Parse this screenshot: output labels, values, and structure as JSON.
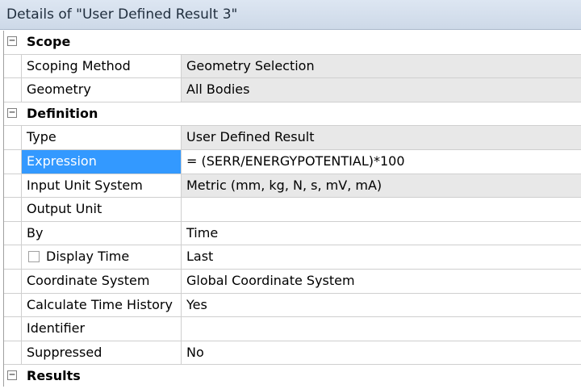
{
  "window": {
    "title": "Details of \"User Defined Result 3\""
  },
  "groups": {
    "scope": {
      "label": "Scope",
      "toggle": "−"
    },
    "definition": {
      "label": "Definition",
      "toggle": "−"
    },
    "results": {
      "label": "Results",
      "toggle": "−"
    }
  },
  "rows": {
    "scoping_method": {
      "name": "Scoping Method",
      "value": "Geometry Selection"
    },
    "geometry": {
      "name": "Geometry",
      "value": "All Bodies"
    },
    "type": {
      "name": "Type",
      "value": "User Defined Result"
    },
    "expression": {
      "name": "Expression",
      "value": "= (SERR/ENERGYPOTENTIAL)*100"
    },
    "input_unit_system": {
      "name": "Input Unit System",
      "value": "Metric (mm, kg, N, s, mV, mA)"
    },
    "output_unit": {
      "name": "Output Unit",
      "value": ""
    },
    "by": {
      "name": "By",
      "value": "Time"
    },
    "display_time": {
      "name": "Display Time",
      "value": "Last",
      "checked": false
    },
    "coordinate_system": {
      "name": "Coordinate System",
      "value": "Global Coordinate System"
    },
    "calculate_time_history": {
      "name": "Calculate Time History",
      "value": "Yes"
    },
    "identifier": {
      "name": "Identifier",
      "value": ""
    },
    "suppressed": {
      "name": "Suppressed",
      "value": "No"
    }
  },
  "colors": {
    "selection": "#3399ff",
    "readonly_bg": "#e8e8e8"
  }
}
